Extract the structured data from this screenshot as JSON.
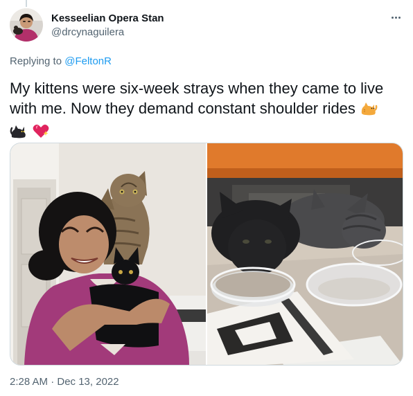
{
  "tweet": {
    "display_name": "Kesseelian Opera Stan",
    "handle": "@drcynaguilera",
    "replying_to_label": "Replying to",
    "replying_to_handle": "@FeltonR",
    "text": "My kittens were six-week strays when they came to live with me. Now they demand constant shoulder rides",
    "emojis": [
      "cat-emoji",
      "black-cat-emoji",
      "sparkling-heart-emoji"
    ],
    "timestamp": "2:28 AM · Dec 13, 2022"
  },
  "media": {
    "photos": [
      {
        "name": "photo-woman-with-two-kittens",
        "subject": "woman holding black kitten with tabby kitten on shoulder"
      },
      {
        "name": "photo-kittens-eating",
        "subject": "black and gray kittens eating from glass bowls"
      }
    ]
  },
  "icons": {
    "more": "more-options-icon"
  },
  "colors": {
    "text_primary": "#0f1419",
    "text_secondary": "#536471",
    "link": "#1d9bf0",
    "border": "#cfd9de"
  }
}
